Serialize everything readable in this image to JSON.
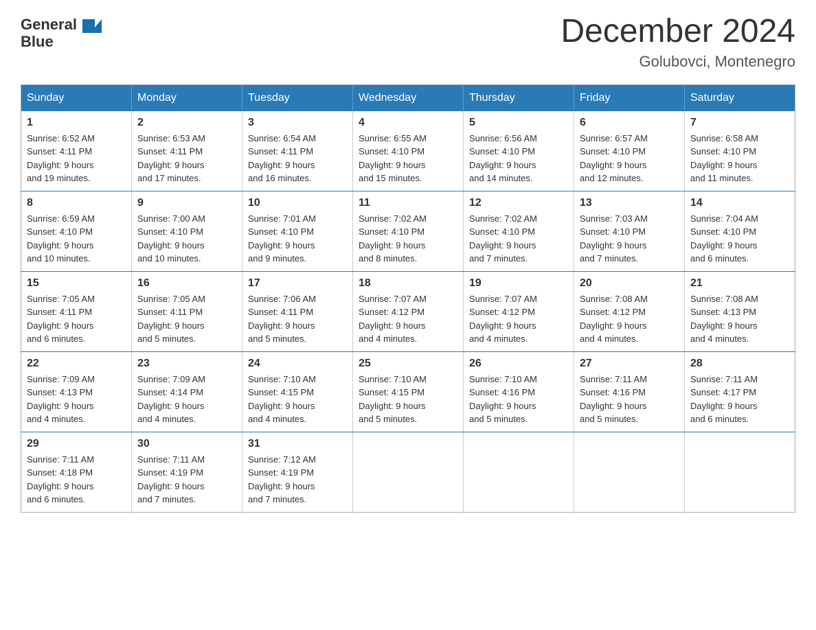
{
  "logo": {
    "text_general": "General",
    "text_blue": "Blue",
    "arrow_color": "#1a6fad"
  },
  "header": {
    "month_title": "December 2024",
    "location": "Golubovci, Montenegro"
  },
  "days_of_week": [
    "Sunday",
    "Monday",
    "Tuesday",
    "Wednesday",
    "Thursday",
    "Friday",
    "Saturday"
  ],
  "weeks": [
    [
      {
        "day": "1",
        "sunrise": "6:52 AM",
        "sunset": "4:11 PM",
        "daylight": "9 hours and 19 minutes."
      },
      {
        "day": "2",
        "sunrise": "6:53 AM",
        "sunset": "4:11 PM",
        "daylight": "9 hours and 17 minutes."
      },
      {
        "day": "3",
        "sunrise": "6:54 AM",
        "sunset": "4:11 PM",
        "daylight": "9 hours and 16 minutes."
      },
      {
        "day": "4",
        "sunrise": "6:55 AM",
        "sunset": "4:10 PM",
        "daylight": "9 hours and 15 minutes."
      },
      {
        "day": "5",
        "sunrise": "6:56 AM",
        "sunset": "4:10 PM",
        "daylight": "9 hours and 14 minutes."
      },
      {
        "day": "6",
        "sunrise": "6:57 AM",
        "sunset": "4:10 PM",
        "daylight": "9 hours and 12 minutes."
      },
      {
        "day": "7",
        "sunrise": "6:58 AM",
        "sunset": "4:10 PM",
        "daylight": "9 hours and 11 minutes."
      }
    ],
    [
      {
        "day": "8",
        "sunrise": "6:59 AM",
        "sunset": "4:10 PM",
        "daylight": "9 hours and 10 minutes."
      },
      {
        "day": "9",
        "sunrise": "7:00 AM",
        "sunset": "4:10 PM",
        "daylight": "9 hours and 10 minutes."
      },
      {
        "day": "10",
        "sunrise": "7:01 AM",
        "sunset": "4:10 PM",
        "daylight": "9 hours and 9 minutes."
      },
      {
        "day": "11",
        "sunrise": "7:02 AM",
        "sunset": "4:10 PM",
        "daylight": "9 hours and 8 minutes."
      },
      {
        "day": "12",
        "sunrise": "7:02 AM",
        "sunset": "4:10 PM",
        "daylight": "9 hours and 7 minutes."
      },
      {
        "day": "13",
        "sunrise": "7:03 AM",
        "sunset": "4:10 PM",
        "daylight": "9 hours and 7 minutes."
      },
      {
        "day": "14",
        "sunrise": "7:04 AM",
        "sunset": "4:10 PM",
        "daylight": "9 hours and 6 minutes."
      }
    ],
    [
      {
        "day": "15",
        "sunrise": "7:05 AM",
        "sunset": "4:11 PM",
        "daylight": "9 hours and 6 minutes."
      },
      {
        "day": "16",
        "sunrise": "7:05 AM",
        "sunset": "4:11 PM",
        "daylight": "9 hours and 5 minutes."
      },
      {
        "day": "17",
        "sunrise": "7:06 AM",
        "sunset": "4:11 PM",
        "daylight": "9 hours and 5 minutes."
      },
      {
        "day": "18",
        "sunrise": "7:07 AM",
        "sunset": "4:12 PM",
        "daylight": "9 hours and 4 minutes."
      },
      {
        "day": "19",
        "sunrise": "7:07 AM",
        "sunset": "4:12 PM",
        "daylight": "9 hours and 4 minutes."
      },
      {
        "day": "20",
        "sunrise": "7:08 AM",
        "sunset": "4:12 PM",
        "daylight": "9 hours and 4 minutes."
      },
      {
        "day": "21",
        "sunrise": "7:08 AM",
        "sunset": "4:13 PM",
        "daylight": "9 hours and 4 minutes."
      }
    ],
    [
      {
        "day": "22",
        "sunrise": "7:09 AM",
        "sunset": "4:13 PM",
        "daylight": "9 hours and 4 minutes."
      },
      {
        "day": "23",
        "sunrise": "7:09 AM",
        "sunset": "4:14 PM",
        "daylight": "9 hours and 4 minutes."
      },
      {
        "day": "24",
        "sunrise": "7:10 AM",
        "sunset": "4:15 PM",
        "daylight": "9 hours and 4 minutes."
      },
      {
        "day": "25",
        "sunrise": "7:10 AM",
        "sunset": "4:15 PM",
        "daylight": "9 hours and 5 minutes."
      },
      {
        "day": "26",
        "sunrise": "7:10 AM",
        "sunset": "4:16 PM",
        "daylight": "9 hours and 5 minutes."
      },
      {
        "day": "27",
        "sunrise": "7:11 AM",
        "sunset": "4:16 PM",
        "daylight": "9 hours and 5 minutes."
      },
      {
        "day": "28",
        "sunrise": "7:11 AM",
        "sunset": "4:17 PM",
        "daylight": "9 hours and 6 minutes."
      }
    ],
    [
      {
        "day": "29",
        "sunrise": "7:11 AM",
        "sunset": "4:18 PM",
        "daylight": "9 hours and 6 minutes."
      },
      {
        "day": "30",
        "sunrise": "7:11 AM",
        "sunset": "4:19 PM",
        "daylight": "9 hours and 7 minutes."
      },
      {
        "day": "31",
        "sunrise": "7:12 AM",
        "sunset": "4:19 PM",
        "daylight": "9 hours and 7 minutes."
      },
      null,
      null,
      null,
      null
    ]
  ],
  "labels": {
    "sunrise": "Sunrise:",
    "sunset": "Sunset:",
    "daylight": "Daylight:"
  }
}
